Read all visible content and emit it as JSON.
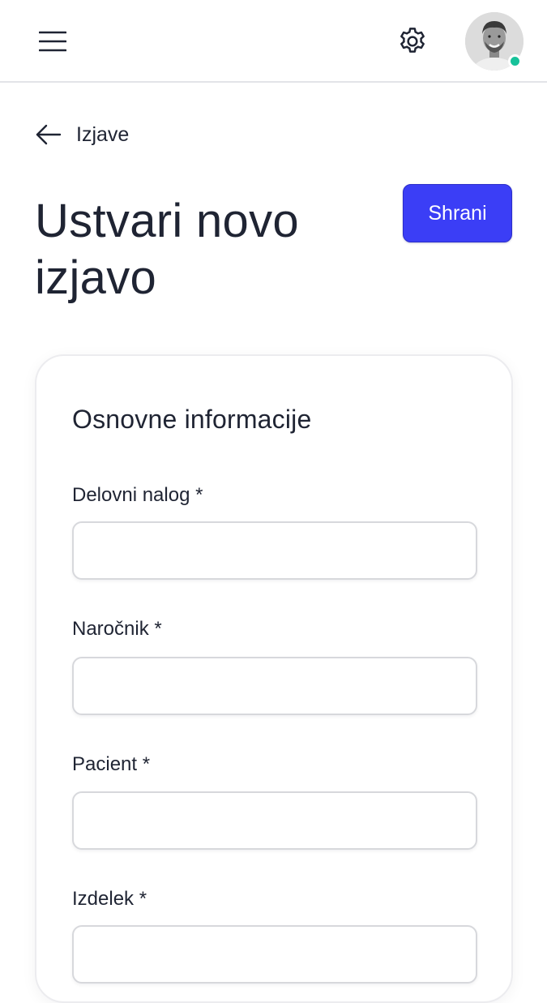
{
  "header": {
    "menu_icon": "hamburger-menu-icon",
    "settings_icon": "gear-icon",
    "status_color": "#17c29a"
  },
  "breadcrumb": {
    "back_label": "Izjave"
  },
  "page": {
    "title": "Ustvari novo izjavo",
    "save_label": "Shrani",
    "accent_color": "#3b3ef6"
  },
  "form": {
    "section_title": "Osnovne informacije",
    "fields": [
      {
        "label": "Delovni nalog *",
        "value": ""
      },
      {
        "label": "Naročnik *",
        "value": ""
      },
      {
        "label": "Pacient *",
        "value": ""
      },
      {
        "label": "Izdelek *",
        "value": ""
      }
    ]
  }
}
